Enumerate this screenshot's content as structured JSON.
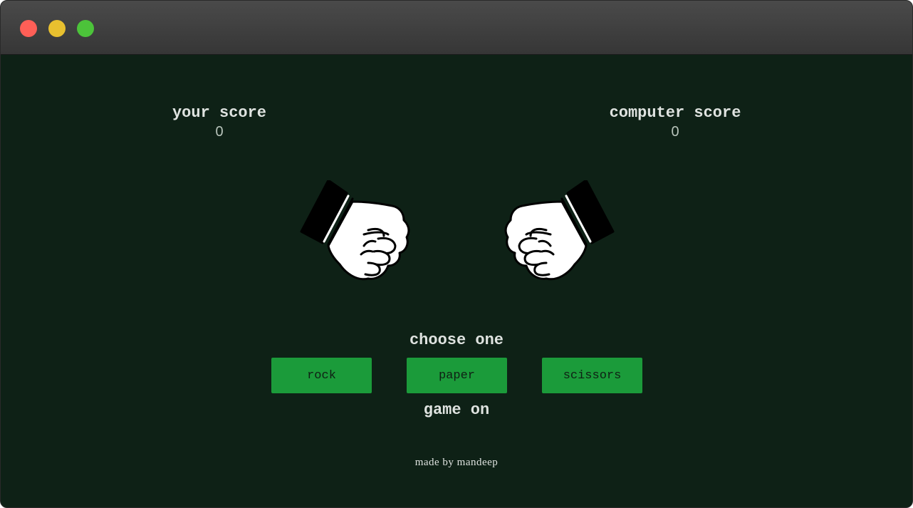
{
  "window": {
    "controls": [
      "close",
      "minimize",
      "maximize"
    ]
  },
  "scores": {
    "user_label": "your score",
    "user_value": "0",
    "computer_label": "computer score",
    "computer_value": "0"
  },
  "hands": {
    "user_icon": "fist-rock-icon",
    "computer_icon": "fist-rock-icon"
  },
  "prompt": "choose one",
  "choices": {
    "rock": "rock",
    "paper": "paper",
    "scissors": "scissors"
  },
  "status": "game on",
  "footer": "made by mandeep",
  "colors": {
    "background": "#0e2116",
    "button": "#1b9b3a",
    "text": "#dfe3e0"
  }
}
